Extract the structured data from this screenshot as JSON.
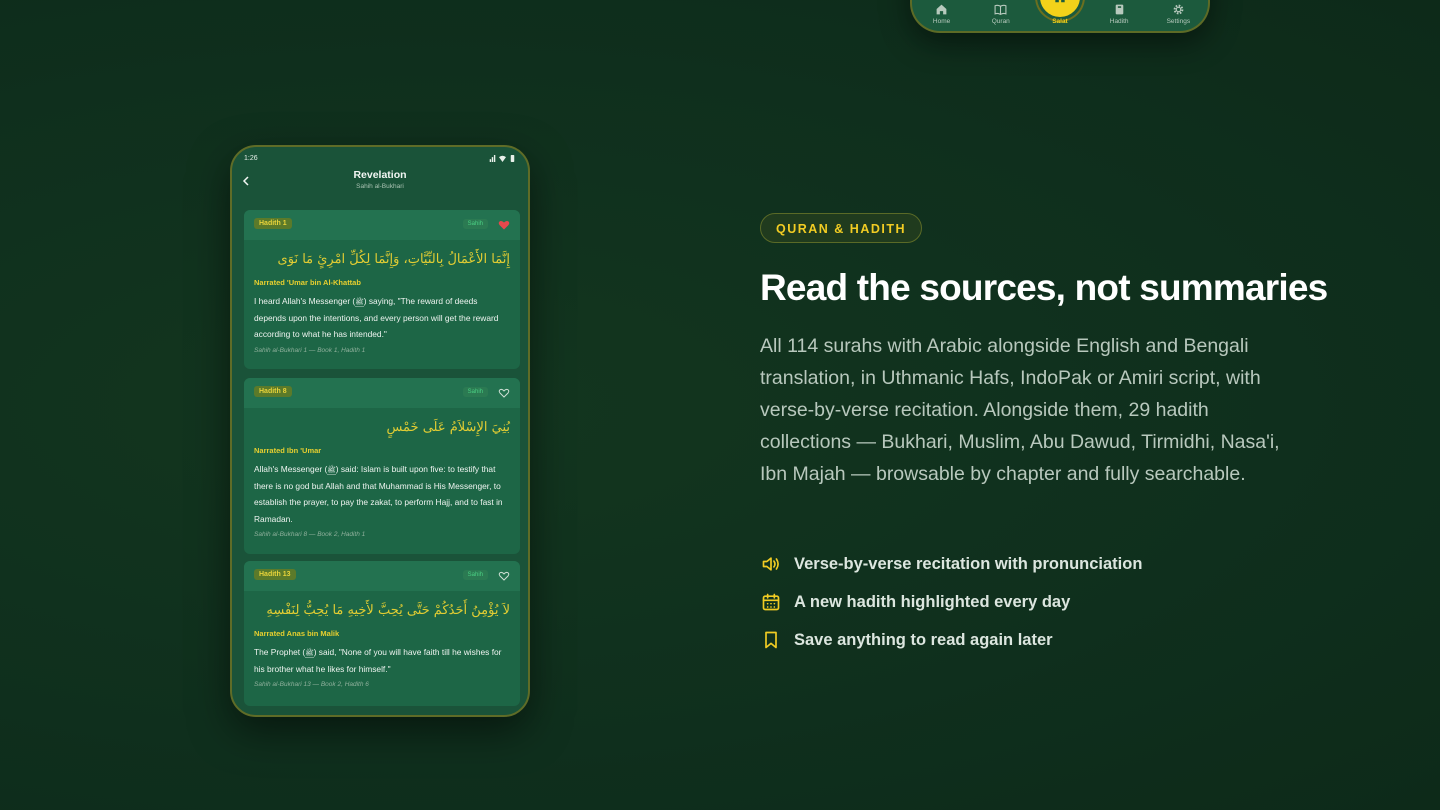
{
  "top_nav": {
    "items": [
      {
        "label": "Home",
        "icon": "home-icon"
      },
      {
        "label": "Quran",
        "icon": "book-open-icon"
      },
      {
        "label": "Salat",
        "icon": "mosque-icon",
        "active": true
      },
      {
        "label": "Hadith",
        "icon": "book-icon"
      },
      {
        "label": "Settings",
        "icon": "gear-icon"
      }
    ]
  },
  "phone": {
    "status_time": "1:26",
    "header": {
      "title": "Revelation",
      "subtitle": "Sahih al-Bukhari"
    },
    "hadiths": [
      {
        "number": "Hadith 1",
        "grade": "Sahih",
        "favorited": true,
        "arabic": "إِنَّمَا الأَعْمَالُ بِالنِّيَّاتِ، وَإِنَّمَا لِكُلِّ امْرِئٍ مَا نَوَى",
        "narrator": "Narrated 'Umar bin Al-Khattab",
        "text_before": "I heard Allah's Messenger (",
        "pbuh": "ﷺ",
        "text_after": ") saying, \"The reward of deeds depends upon the intentions, and every person will get the reward according to what he has intended.\"",
        "reference": "Sahih al-Bukhari 1 — Book 1, Hadith 1"
      },
      {
        "number": "Hadith 8",
        "grade": "Sahih",
        "favorited": false,
        "arabic": "بُنِيَ الإِسْلاَمُ عَلَى خَمْسٍ",
        "narrator": "Narrated Ibn 'Umar",
        "text_before": "Allah's Messenger (",
        "pbuh": "ﷺ",
        "text_after": ") said: Islam is built upon five: to testify that there is no god but Allah and that Muhammad is His Messenger, to establish the prayer, to pay the zakat, to perform Hajj, and to fast in Ramadan.",
        "reference": "Sahih al-Bukhari 8 — Book 2, Hadith 1"
      },
      {
        "number": "Hadith 13",
        "grade": "Sahih",
        "favorited": false,
        "arabic": "لاَ يُؤْمِنُ أَحَدُكُمْ حَتَّى يُحِبَّ لأَخِيهِ مَا يُحِبُّ لِنَفْسِهِ",
        "narrator": "Narrated Anas bin Malik",
        "text_before": "The Prophet (",
        "pbuh": "ﷺ",
        "text_after": ") said, \"None of you will have faith till he wishes for his brother what he likes for himself.\"",
        "reference": "Sahih al-Bukhari 13 — Book 2, Hadith 6"
      }
    ]
  },
  "section": {
    "tag": "QURAN & HADITH",
    "headline": "Read the sources, not summaries",
    "description": "All 114 surahs with Arabic alongside English and Bengali translation, in Uthmanic Hafs, IndoPak or Amiri script, with verse-by-verse recitation. Alongside them, 29 hadith collections — Bukhari, Muslim, Abu Dawud, Tirmidhi, Nasa'i, Ibn Majah — browsable by chapter and fully searchable.",
    "features": [
      {
        "icon": "speaker-icon",
        "text": "Verse-by-verse recitation with pronunciation"
      },
      {
        "icon": "calendar-icon",
        "text": "A new hadith highlighted every day"
      },
      {
        "icon": "bookmark-icon",
        "text": "Save anything to read again later"
      }
    ]
  },
  "colors": {
    "background": "#0f2f1d",
    "accent": "#f2cc23",
    "phone_bg": "#1a5339",
    "card_bg": "#1d6646",
    "favorite": "#e5484d"
  }
}
